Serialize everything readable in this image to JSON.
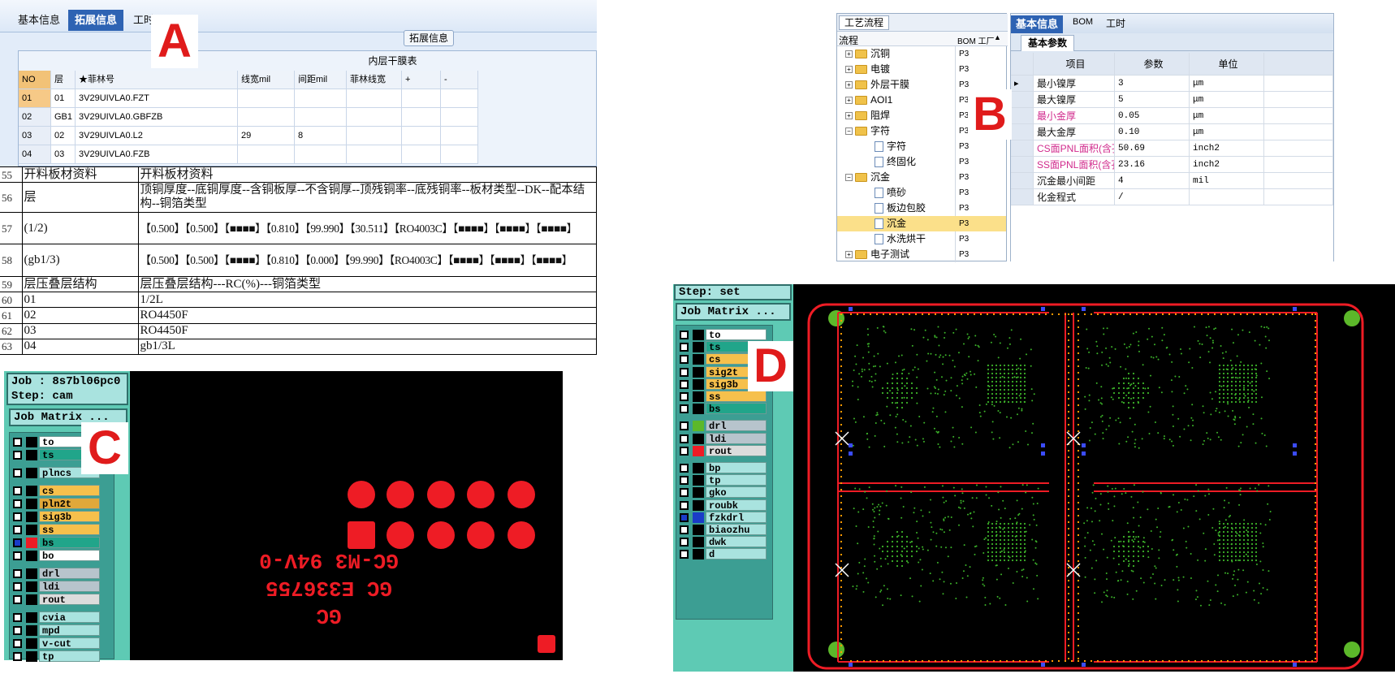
{
  "panel_a": {
    "tabs": [
      "基本信息",
      "拓展信息",
      "工时"
    ],
    "group_button": "拓展信息",
    "table_title": "内层干膜表",
    "headers": [
      "NO",
      "层",
      "★菲林号",
      "线宽mil",
      "间距mil",
      "菲林线宽",
      "+",
      "-"
    ],
    "rows": [
      [
        "01",
        "01",
        "3V29UIVLA0.FZT",
        "",
        "",
        ""
      ],
      [
        "02",
        "GB1",
        "3V29UIVLA0.GBFZB",
        "",
        "",
        ""
      ],
      [
        "03",
        "02",
        "3V29UIVLA0.L2",
        "29",
        "8",
        ""
      ],
      [
        "04",
        "03",
        "3V29UIVLA0.FZB",
        "",
        "",
        ""
      ]
    ],
    "letter": "A"
  },
  "panel_a2": {
    "rows": [
      {
        "n": "55",
        "a": "开料板材资料",
        "b": "开料板材资料"
      },
      {
        "n": "56",
        "a": "层",
        "b": "顶铜厚度--底铜厚度--含铜板厚--不含铜厚--顶残铜率--底残铜率--板材类型--DK--配本结构--铜箔类型"
      },
      {
        "n": "57",
        "a": "(1/2)",
        "b": "【0.500】【0.500】【■■■■】【0.810】【99.990】【30.511】【RO4003C】【■■■■】【■■■■】【■■■■】"
      },
      {
        "n": "58",
        "a": "(gb1/3)",
        "b": "【0.500】【0.500】【■■■■】【0.810】【0.000】【99.990】【RO4003C】【■■■■】【■■■■】【■■■■】"
      },
      {
        "n": "59",
        "a": "层压叠层结构",
        "b": "层压叠层结构---RC(%)---铜箔类型"
      },
      {
        "n": "60",
        "a": "01",
        "b": "1/2L"
      },
      {
        "n": "61",
        "a": "02",
        "b": "RO4450F"
      },
      {
        "n": "62",
        "a": "03",
        "b": "RO4450F"
      },
      {
        "n": "63",
        "a": "04",
        "b": "gb1/3L"
      }
    ]
  },
  "panel_b": {
    "tree_tab": "工艺流程",
    "tree_header": [
      "流程",
      "BOM 工厂"
    ],
    "tree": [
      {
        "label": "沉铜",
        "bom": "P3",
        "type": "folder",
        "level": 0
      },
      {
        "label": "电镀",
        "bom": "P3",
        "type": "folder",
        "level": 0
      },
      {
        "label": "外层干膜",
        "bom": "P3",
        "type": "folder",
        "level": 0
      },
      {
        "label": "AOI1",
        "bom": "P3",
        "type": "folder",
        "level": 0
      },
      {
        "label": "阻焊",
        "bom": "P3",
        "type": "folder",
        "level": 0
      },
      {
        "label": "字符",
        "bom": "P3",
        "type": "folder",
        "level": 0
      },
      {
        "label": "字符",
        "bom": "P3",
        "type": "doc",
        "level": 1
      },
      {
        "label": "终固化",
        "bom": "P3",
        "type": "doc",
        "level": 1
      },
      {
        "label": "沉金",
        "bom": "P3",
        "type": "folder",
        "level": 0
      },
      {
        "label": "喷砂",
        "bom": "P3",
        "type": "doc",
        "level": 1
      },
      {
        "label": "板边包胶",
        "bom": "P3",
        "type": "doc",
        "level": 1
      },
      {
        "label": "沉金",
        "bom": "P3",
        "type": "doc",
        "level": 1,
        "selected": true
      },
      {
        "label": "水洗烘干",
        "bom": "P3",
        "type": "doc",
        "level": 1
      },
      {
        "label": "电子测试",
        "bom": "P3",
        "type": "folder",
        "level": 0
      }
    ],
    "tabs": [
      "基本信息",
      "BOM",
      "工时"
    ],
    "subtab": "基本参数",
    "col_headers": [
      "项目",
      "参数",
      "单位"
    ],
    "rows": [
      {
        "item": "最小镍厚",
        "value": "3",
        "unit": "μm",
        "pink": false
      },
      {
        "item": "最大镍厚",
        "value": "5",
        "unit": "μm",
        "pink": false
      },
      {
        "item": "最小金厚",
        "value": "0.05",
        "unit": "μm",
        "pink": true
      },
      {
        "item": "最大金厚",
        "value": "0.10",
        "unit": "μm",
        "pink": false
      },
      {
        "item": "CS面PNL面积(含孔)",
        "value": "50.69",
        "unit": "inch2",
        "pink": true
      },
      {
        "item": "SS面PNL面积(含孔)",
        "value": "23.16",
        "unit": "inch2",
        "pink": true
      },
      {
        "item": "沉金最小间距",
        "value": "4",
        "unit": "mil",
        "pink": false
      },
      {
        "item": "化金程式",
        "value": "/",
        "unit": "",
        "pink": false
      }
    ],
    "letter": "B"
  },
  "panel_c": {
    "job": "Job : 8s7bl06pc0",
    "step": "Step: cam",
    "matrix_button": "Job Matrix ...",
    "layers": [
      {
        "name": "to",
        "color": "#ffffff"
      },
      {
        "name": "ts",
        "color": "#21a58a"
      },
      {
        "name": "plncs",
        "color": "#a9e3df"
      },
      {
        "name": "cs",
        "color": "#f6c04c"
      },
      {
        "name": "pln2t",
        "color": "#e0a83a"
      },
      {
        "name": "sig3b",
        "color": "#f6c04c"
      },
      {
        "name": "ss",
        "color": "#f6c04c"
      },
      {
        "name": "bs",
        "color": "#21a58a"
      },
      {
        "name": "bo",
        "color": "#ffffff"
      },
      {
        "name": "drl",
        "color": "#b7c4cc"
      },
      {
        "name": "ldi",
        "color": "#b7c4cc"
      },
      {
        "name": "rout",
        "color": "#dcdcdc"
      },
      {
        "name": "cvia",
        "color": "#a9e3df"
      },
      {
        "name": "mpd",
        "color": "#a9e3df"
      },
      {
        "name": "v-cut",
        "color": "#a9e3df"
      },
      {
        "name": "tp",
        "color": "#a9e3df"
      }
    ],
    "silk_text": [
      "GC-M3 94V-0",
      "GC E336755",
      "GC"
    ],
    "letter": "C"
  },
  "panel_d": {
    "step": "Step: set",
    "matrix_button": "Job Matrix ...",
    "layers": [
      {
        "name": "to",
        "color": "#ffffff"
      },
      {
        "name": "ts",
        "color": "#21a58a"
      },
      {
        "name": "cs",
        "color": "#f6c04c"
      },
      {
        "name": "sig2t",
        "color": "#f6c04c"
      },
      {
        "name": "sig3b",
        "color": "#f6c04c"
      },
      {
        "name": "ss",
        "color": "#f6c04c"
      },
      {
        "name": "bs",
        "color": "#21a58a"
      },
      {
        "name": "drl",
        "color": "#b7c4cc"
      },
      {
        "name": "ldi",
        "color": "#b7c4cc"
      },
      {
        "name": "rout",
        "color": "#dcdcdc"
      },
      {
        "name": "bp",
        "color": "#a9e3df"
      },
      {
        "name": "tp",
        "color": "#a9e3df"
      },
      {
        "name": "gko",
        "color": "#a9e3df"
      },
      {
        "name": "roubk",
        "color": "#a9e3df"
      },
      {
        "name": "fzkdrl",
        "color": "#a9e3df"
      },
      {
        "name": "biaozhu",
        "color": "#a9e3df"
      },
      {
        "name": "dwk",
        "color": "#a9e3df"
      },
      {
        "name": "d",
        "color": "#a9e3df"
      }
    ],
    "letter": "D"
  }
}
